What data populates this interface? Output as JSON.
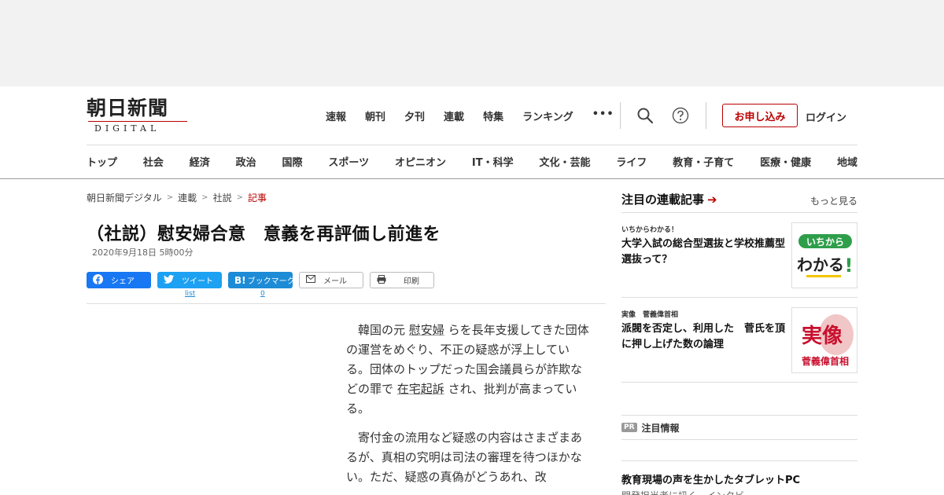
{
  "header": {
    "logo_main": "朝日新聞",
    "logo_sub": "DIGITAL",
    "topnav": [
      "速報",
      "朝刊",
      "夕刊",
      "連載",
      "特集",
      "ランキング"
    ],
    "more_label": "•••",
    "apply_label": "お申し込み",
    "login_label": "ログイン",
    "categories": [
      "トップ",
      "社会",
      "経済",
      "政治",
      "国際",
      "スポーツ",
      "オピニオン",
      "IT・科学",
      "文化・芸能",
      "ライフ",
      "教育・子育て",
      "医療・健康",
      "地域"
    ]
  },
  "breadcrumb": [
    "朝日新聞デジタル",
    "連載",
    "社説",
    "記事"
  ],
  "article": {
    "title": "（社説）慰安婦合意　意義を再評価し前進を",
    "date": "2020年9月18日 5時00分",
    "share": {
      "facebook": "シェア",
      "twitter": "ツイート",
      "hatena": "ブックマーク",
      "mail": "メール",
      "print": "印刷",
      "twitter_count": "list",
      "hatena_count": "0"
    },
    "p1_a": "韓国の元",
    "p1_link1": "慰安婦",
    "p1_b": "らを長年支援してきた団体の運営をめぐり、不正の疑惑が浮上している。団体のトップだった国会議員らが詐欺などの罪で",
    "p1_link2": "在宅起訴",
    "p1_c": "され、批判が高まっている。",
    "p2": "寄付金の流用など疑惑の内容はさまざまあるが、真相の究明は司法の審理を待つほかない。ただ、疑惑の真偽がどうあれ、改"
  },
  "sidebar": {
    "title": "注目の連載記事",
    "more": "もっと見る",
    "items": [
      {
        "series": "いちからわかる！",
        "headline": "大学入試の総合型選抜と学校推薦型選抜って？",
        "thumb_text_1": "いちから",
        "thumb_text_2": "わかる",
        "thumb_text_3": "!"
      },
      {
        "series": "実像　菅義偉首相",
        "headline": "派閥を否定し、利用した　菅氏を頂に押し上げた数の論理",
        "thumb_text_1": "実像",
        "thumb_text_2": "菅義偉首相"
      }
    ]
  },
  "pr": {
    "badge": "PR",
    "label": "注目情報",
    "title": "教育現場の声を生かしたタブレットPC",
    "sub": "開発担当者に訊く、インタビ"
  },
  "colors": {
    "brand_red": "#bb0000",
    "facebook": "#1877f2",
    "twitter": "#1da1f2",
    "hatena": "#1d8bd6"
  }
}
